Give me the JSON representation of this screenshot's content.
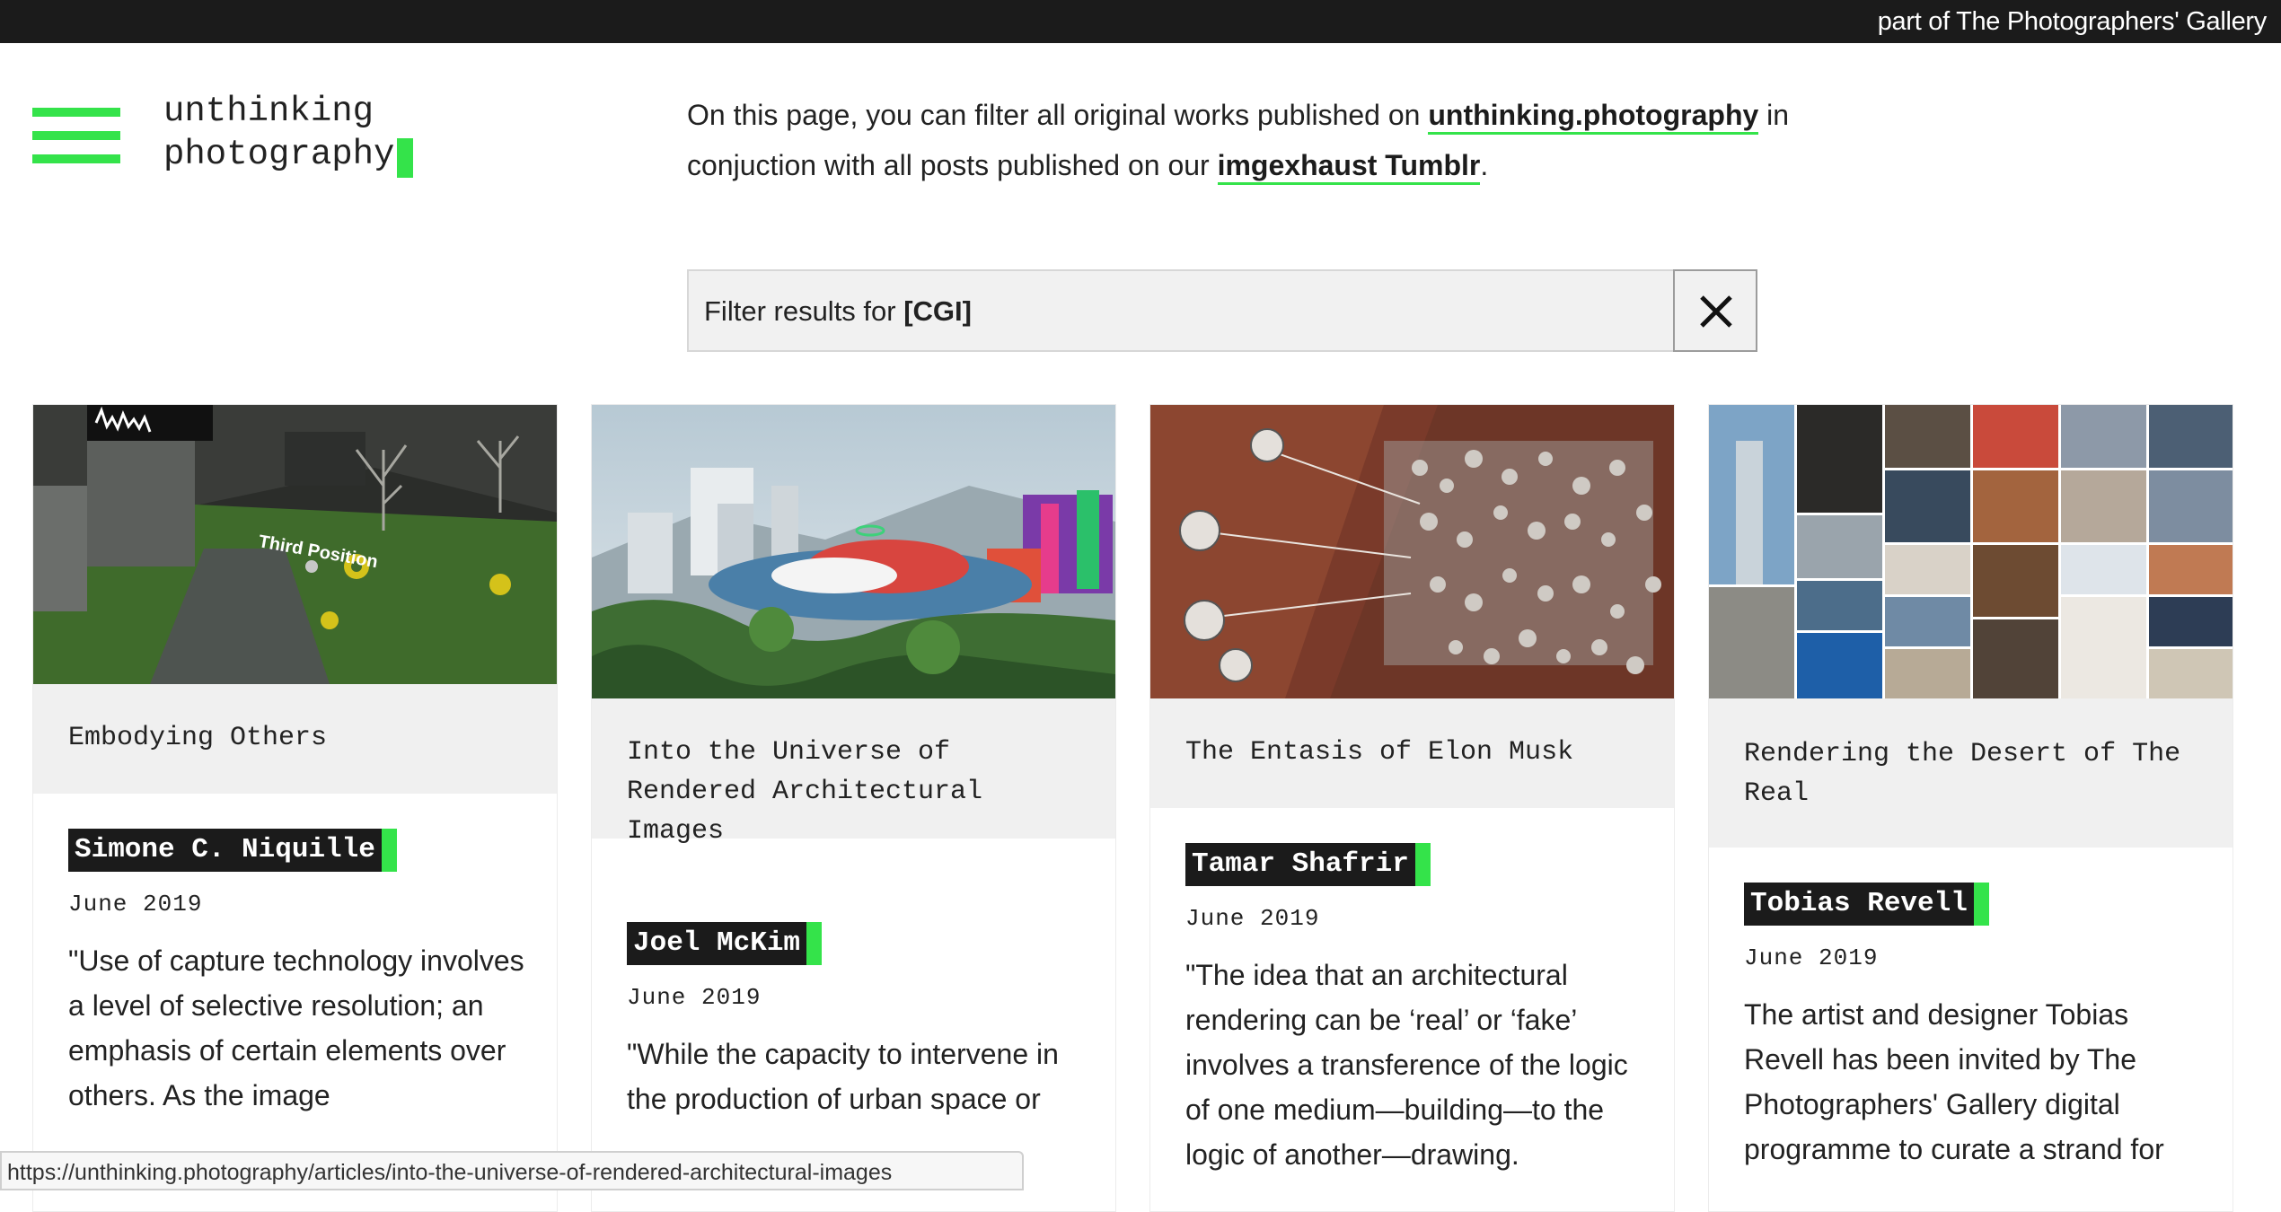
{
  "topbar": {
    "link_text": "part of The Photographers' Gallery"
  },
  "header": {
    "logo_line1": "unthinking",
    "logo_line2": "photography",
    "accent_color": "#34e34a"
  },
  "intro": {
    "text_1": "On this page, you can filter all original works published on ",
    "link_1": "unthinking.photography",
    "text_2": " in conjuction with all posts published on our ",
    "link_2": "imgexhaust Tumblr",
    "text_3": "."
  },
  "filter": {
    "label": "Filter results for ",
    "tag": "[CGI]",
    "close_icon": "close-icon"
  },
  "cards": [
    {
      "title": "Embodying Others",
      "author": "Simone C. Niquille",
      "date": "June 2019",
      "excerpt": "\"Use of capture technology involves a level of selective resolution; an emphasis of certain elements over others. As the image",
      "image_text": "Third Position"
    },
    {
      "title": "Into the Universe of Rendered Architectural Images",
      "author": "Joel McKim",
      "date": "June 2019",
      "excerpt": "\"While the capacity to intervene in the production of urban space or"
    },
    {
      "title": "The Entasis of Elon Musk",
      "author": "Tamar Shafrir",
      "date": "June 2019",
      "excerpt": "\"The idea that an architectural rendering can be ‘real’ or ‘fake’ involves a transference of the logic of one medium—building—to the logic of another—drawing."
    },
    {
      "title": "Rendering the Desert of The Real",
      "author": "Tobias Revell",
      "date": "June 2019",
      "excerpt": "The artist and designer Tobias Revell has been invited by The Photographers' Gallery digital programme to curate a strand for"
    }
  ],
  "statusbar": {
    "url": "https://unthinking.photography/articles/into-the-universe-of-rendered-architectural-images"
  }
}
